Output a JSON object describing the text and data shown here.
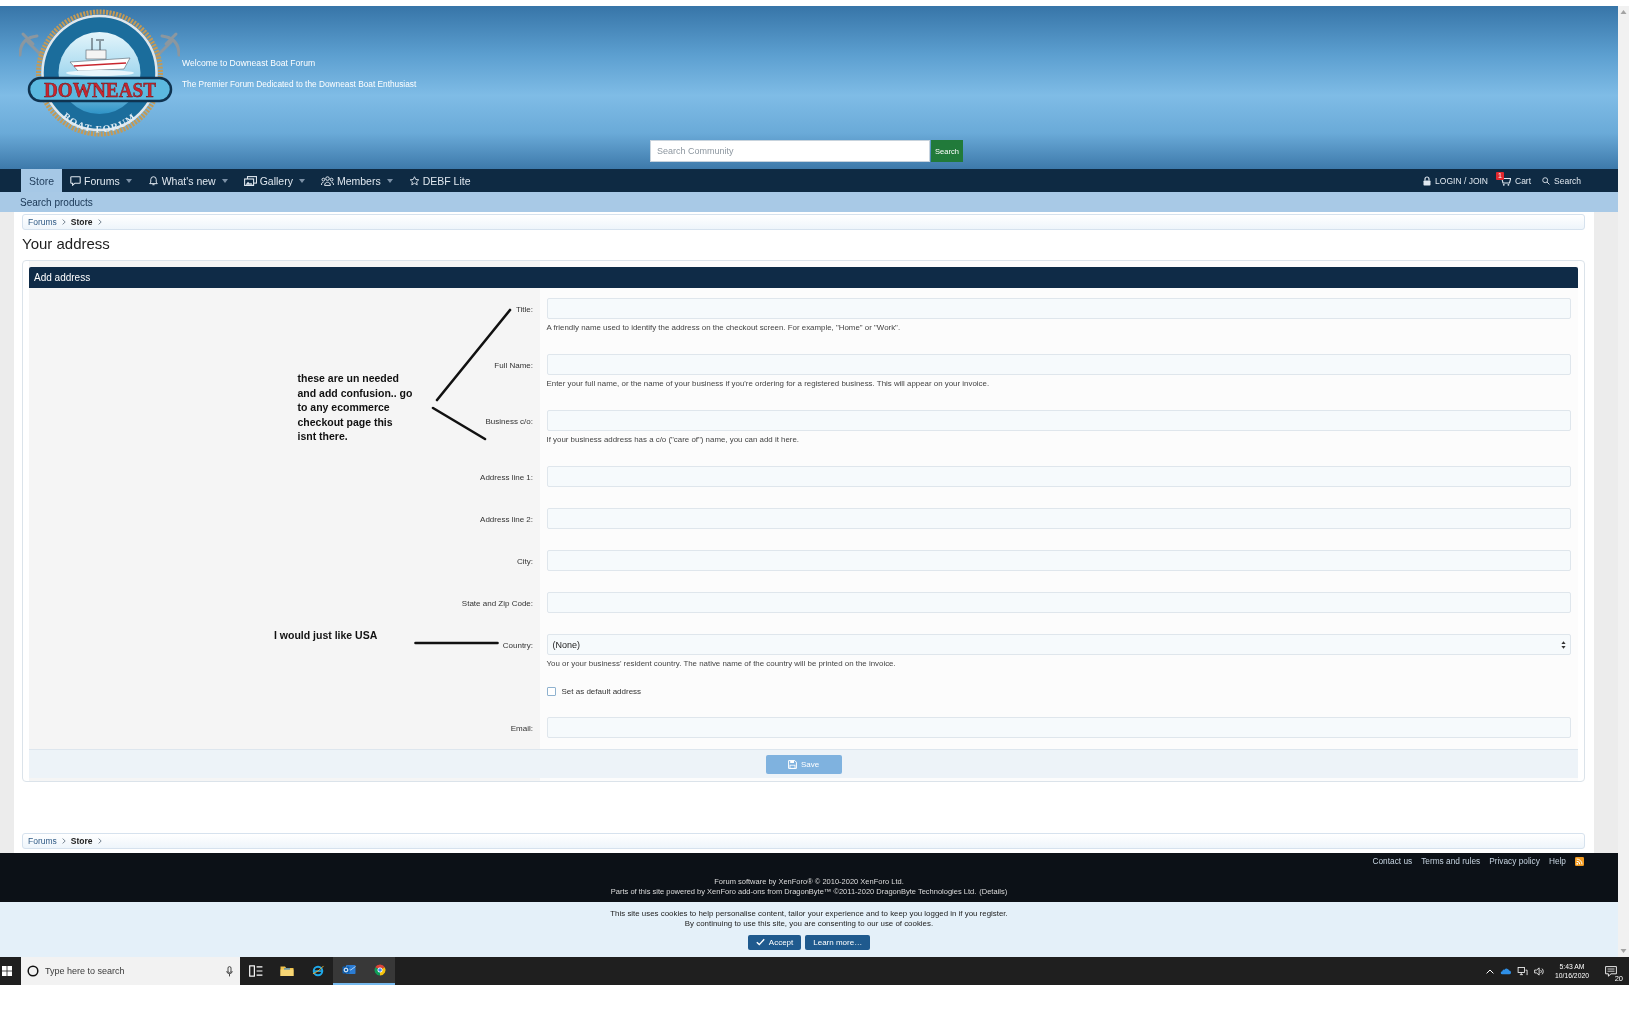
{
  "header": {
    "logo": {
      "title": "DOWNEAST",
      "subtitle": "BOAT FORUM"
    },
    "welcome": "Welcome to Downeast Boat Forum",
    "tagline": "The Premier Forum Dedicated to the Downeast Boat Enthusiast",
    "search": {
      "placeholder": "Search Community",
      "button": "Search"
    }
  },
  "nav": {
    "tabs": [
      {
        "label": "Store",
        "selected": true,
        "has_menu": false
      },
      {
        "label": "Forums",
        "selected": false,
        "has_menu": true
      },
      {
        "label": "What's new",
        "selected": false,
        "has_menu": true
      },
      {
        "label": "Gallery",
        "selected": false,
        "has_menu": true
      },
      {
        "label": "Members",
        "selected": false,
        "has_menu": true
      },
      {
        "label": "DEBF Lite",
        "selected": false,
        "has_menu": false
      }
    ],
    "account": {
      "login": "LOGIN / JOIN",
      "cart": "Cart",
      "cart_badge": "1",
      "search": "Search"
    }
  },
  "sub_nav": {
    "links": [
      "Search products"
    ]
  },
  "breadcrumb_top": [
    {
      "label": "Forums",
      "current": false
    },
    {
      "label": "Store",
      "current": true
    }
  ],
  "page_title": "Your address",
  "form": {
    "heading": "Add address",
    "fields": [
      {
        "kind": "text",
        "label": "Title:",
        "explain": "A friendly name used to identify the address on the checkout screen. For example, \"Home\" or \"Work\"."
      },
      {
        "kind": "text",
        "label": "Full Name:",
        "explain": "Enter your full name, or the name of your business if you're ordering for a registered business. This will appear on your invoice."
      },
      {
        "kind": "text",
        "label": "Business c/o:",
        "explain": "If your business address has a c/o (\"care of\") name, you can add it here."
      },
      {
        "kind": "text",
        "label": "Address line 1:"
      },
      {
        "kind": "text",
        "label": "Address line 2:"
      },
      {
        "kind": "text",
        "label": "City:"
      },
      {
        "kind": "text",
        "label": "State and Zip Code:"
      },
      {
        "kind": "select",
        "label": "Country:",
        "value": "(None)",
        "explain": "You or your business' resident country. The native name of the country will be printed on the invoice."
      },
      {
        "kind": "checkbox",
        "label": "Set as default address",
        "checked": false
      },
      {
        "kind": "text",
        "label": "Email:"
      }
    ],
    "save_button": "Save"
  },
  "annotations": [
    {
      "kind": "bracket",
      "text": "these are un needed and add confusion.. go to any ecommerce checkout page this isnt there."
    },
    {
      "kind": "line",
      "text": "I would just like USA"
    }
  ],
  "breadcrumb_bottom": [
    {
      "label": "Forums",
      "current": false
    },
    {
      "label": "Store",
      "current": true
    }
  ],
  "footer": {
    "links": [
      "Contact us",
      "Terms and rules",
      "Privacy policy",
      "Help"
    ],
    "credits": "Forum software by XenForo® © 2010-2020 XenForo Ltd.",
    "addons": {
      "text": "Parts of this site powered by XenForo add-ons from DragonByte™ ©2011-2020 DragonByte Technologies Ltd.",
      "link": "(Details)"
    }
  },
  "cookie_notice": {
    "lines": [
      "This site uses cookies to help personalise content, tailor your experience and to keep you logged in if you register.",
      "By continuing to use this site, you are consenting to our use of cookies."
    ],
    "buttons": [
      {
        "kind": "accept",
        "label": "Accept"
      },
      {
        "kind": "more",
        "label": "Learn more…"
      }
    ]
  },
  "taskbar": {
    "search_placeholder": "Type here to search",
    "apps": [
      {
        "open": false
      },
      {
        "open": false
      },
      {
        "open": true
      },
      {
        "open": true
      }
    ],
    "clock": {
      "time": "5:43 AM",
      "date": "10/16/2020"
    },
    "notifications": "20"
  }
}
